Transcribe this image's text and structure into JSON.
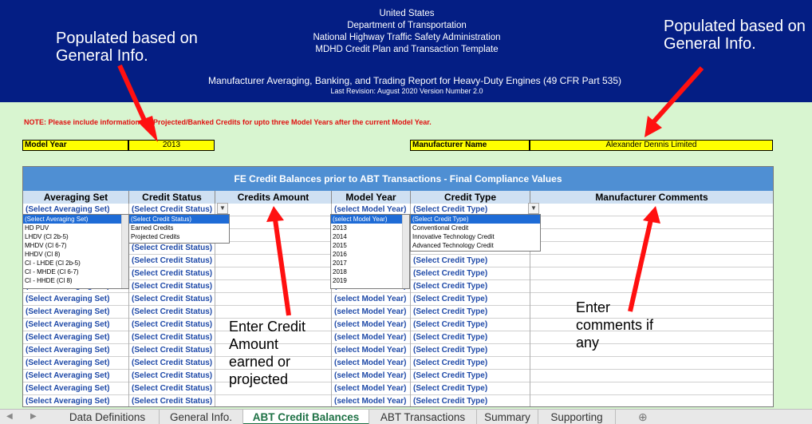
{
  "header": {
    "lines": [
      "United States",
      "Department of Transportation",
      "National Highway Traffic Safety Administration",
      "MDHD Credit Plan and Transaction Template"
    ],
    "subtitle": "Manufacturer Averaging, Banking, and Trading Report for Heavy-Duty Engines (49 CFR Part 535)",
    "revision": "Last Revision: August 2020    Version Number 2.0",
    "callout_left": "Populated based on General Info.",
    "callout_right": "Populated based on General Info."
  },
  "note": "NOTE: Please include information for Projected/Banked Credits for upto three Model Years after the current Model Year.",
  "info": {
    "model_year_label": "Model Year",
    "model_year_value": "2013",
    "manufacturer_label": "Manufacturer Name",
    "manufacturer_value": "Alexander Dennis Limited"
  },
  "table": {
    "title": "FE Credit Balances prior to ABT Transactions - Final Compliance Values",
    "headers": [
      "Averaging Set",
      "Credit Status",
      "Credits Amount",
      "Model Year",
      "Credit Type",
      "Manufacturer Comments"
    ],
    "placeholders": {
      "averaging_set": "(Select Averaging Set)",
      "credit_status": "(Select Credit Status)",
      "model_year": "(select Model Year)",
      "credit_type": "(Select Credit Type)"
    }
  },
  "dropdowns": {
    "averaging_set": [
      "(Select Averaging Set)",
      "HD PUV",
      "LHDV (Cl 2b-5)",
      "MHDV (Cl 6-7)",
      "HHDV (Cl 8)",
      "CI - LHDE (Cl 2b-5)",
      "CI - MHDE (Cl 6-7)",
      "CI - HHDE (Cl 8)"
    ],
    "credit_status": [
      "(Select Credit Status)",
      "Earned Credits",
      "Projected Credits"
    ],
    "model_year": [
      "(select Model Year)",
      "2013",
      "2014",
      "2015",
      "2016",
      "2017",
      "2018",
      "2019"
    ],
    "credit_type": [
      "(Select Credit Type)",
      "Conventional Credit",
      "Innovative Technology Credit",
      "Advanced Technology Credit"
    ]
  },
  "annotations": {
    "credit_amount": [
      "Enter Credit",
      "Amount",
      "earned or",
      "projected"
    ],
    "comments": [
      "Enter",
      "comments if",
      "any"
    ]
  },
  "tabs": [
    "Data Definitions",
    "General Info.",
    "ABT Credit Balances",
    "ABT Transactions",
    "Summary",
    "Supporting"
  ],
  "active_tab": "ABT Credit Balances",
  "colors": {
    "header_bg": "#041e84",
    "sheet_bg": "#d8f5d0",
    "table_title_bg": "#4f8fd3",
    "highlight": "#ffff00",
    "arrow": "#ff1010",
    "selected_item": "#1e6bd6",
    "active_tab_text": "#1e7145"
  },
  "icons": [
    "add-sheet-icon",
    "dropdown-arrow-icon",
    "nav-arrow-icon"
  ]
}
